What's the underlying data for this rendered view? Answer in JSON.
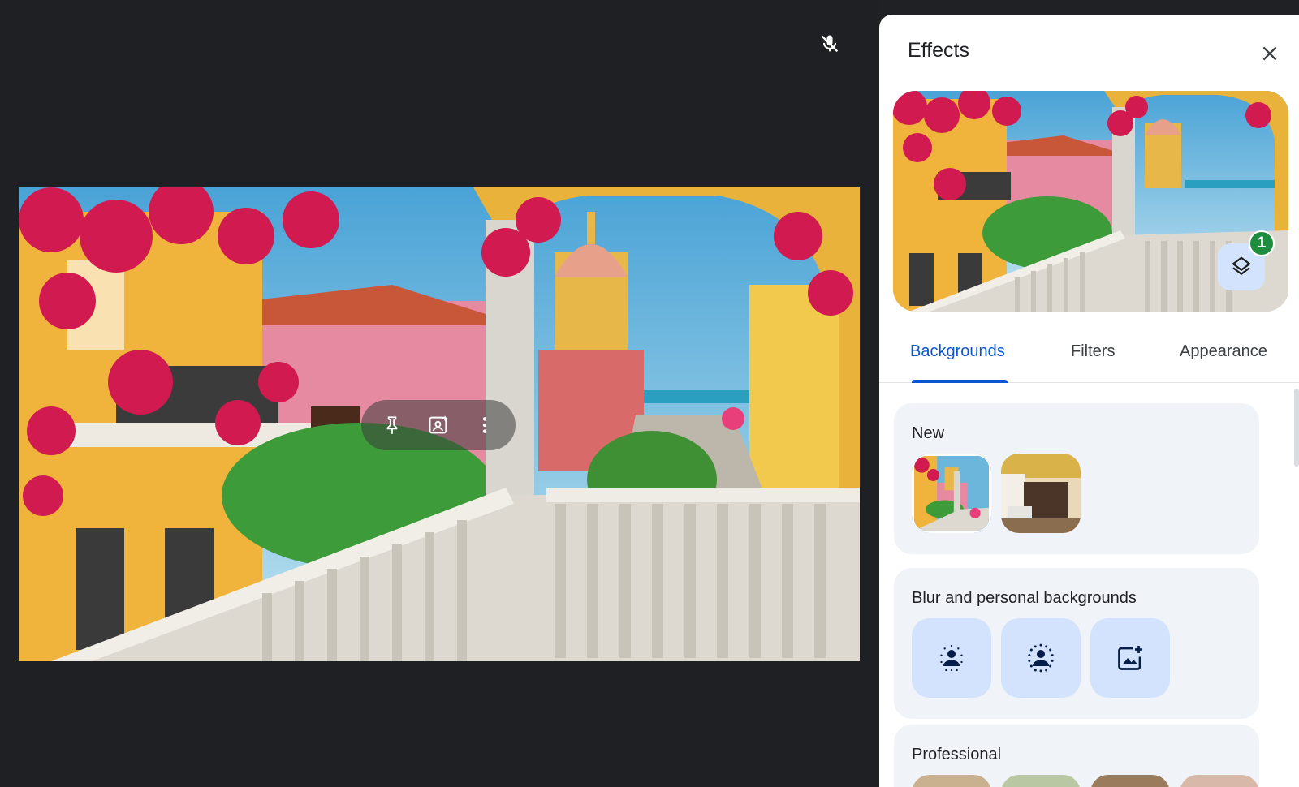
{
  "panel": {
    "title": "Effects",
    "layers_badge": "1",
    "tabs": [
      {
        "label": "Backgrounds",
        "active": true
      },
      {
        "label": "Filters",
        "active": false
      },
      {
        "label": "Appearance",
        "active": false
      }
    ],
    "sections": [
      {
        "title": "New"
      },
      {
        "title": "Blur and personal backgrounds"
      },
      {
        "title": "Professional"
      }
    ]
  },
  "icons": {
    "mic": "mic-off-icon",
    "pin": "pin-icon",
    "frame": "portrait-frame-icon",
    "more": "more-vert-icon",
    "close": "close-icon",
    "layers": "layers-icon",
    "blur_slight": "slight-blur-icon",
    "blur_full": "background-blur-icon",
    "upload": "add-image-icon"
  },
  "colors": {
    "accent": "#0b57d0",
    "badge": "#1e8e3e",
    "tile_bg": "#d3e3fd",
    "section_bg": "#f0f4f9",
    "stage_bg": "#1f2024"
  }
}
